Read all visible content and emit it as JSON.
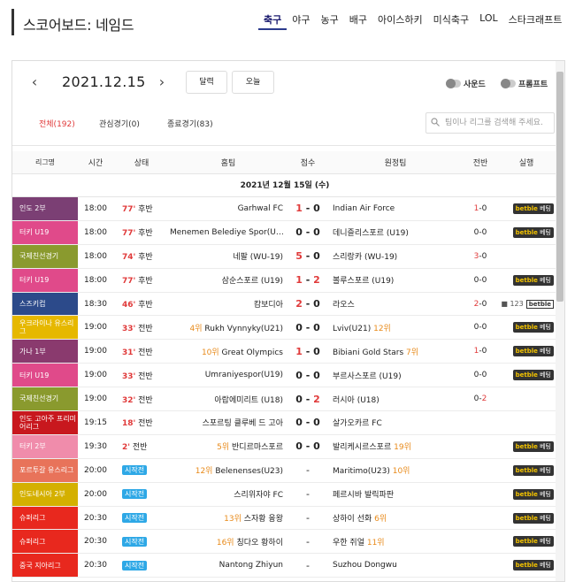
{
  "header": {
    "title": "스코어보드: 네임드",
    "nav": [
      "축구",
      "야구",
      "농구",
      "배구",
      "아이스하키",
      "미식축구",
      "LOL",
      "스타크래프트"
    ]
  },
  "controls": {
    "date": "2021.12.15",
    "calendar_label": "달력",
    "today_label": "오늘",
    "sound_label": "사운드",
    "proto_label": "프롬프트",
    "tabs": [
      "전체(192)",
      "관심경기(0)",
      "종료경기(83)"
    ],
    "search_placeholder": "팀이나 리그를 검색해 주세요."
  },
  "table": {
    "columns": [
      "리그명",
      "시간",
      "상태",
      "홈팀",
      "점수",
      "원정팀",
      "전반",
      "실행"
    ],
    "date_header": "2021년 12월 15일 (수)",
    "rows": [
      {
        "league": "인도 2부",
        "color": "#7b3f74",
        "time": "18:00",
        "status_min": "77'",
        "status": "후반",
        "home_rank": "",
        "home": "Garhwal FC",
        "score_h": "1",
        "score_a": "0",
        "away": "Indian Air Force",
        "away_rank": "",
        "half_h": "1",
        "half_a": "0",
        "action": "betble"
      },
      {
        "league": "터키 U19",
        "color": "#e04a8a",
        "time": "18:00",
        "status_min": "77'",
        "status": "후반",
        "home_rank": "",
        "home": "Menemen Belediye Spor(U…",
        "score_h": "0",
        "score_a": "0",
        "away": "데니즐리스포르 (U19)",
        "away_rank": "",
        "half_h": "0",
        "half_a": "0",
        "action": "betble"
      },
      {
        "league": "국제친선경기",
        "color": "#8a9a2e",
        "time": "18:00",
        "status_min": "74'",
        "status": "후반",
        "home_rank": "",
        "home": "네팔 (WU-19)",
        "score_h": "5",
        "score_a": "0",
        "away": "스리랑카 (WU-19)",
        "away_rank": "",
        "half_h": "3",
        "half_a": "0",
        "action": ""
      },
      {
        "league": "터키 U19",
        "color": "#e04a8a",
        "time": "18:00",
        "status_min": "77'",
        "status": "후반",
        "home_rank": "",
        "home": "삼순스포르 (U19)",
        "score_h": "1",
        "score_a": "2",
        "away": "볼루스포르 (U19)",
        "away_rank": "",
        "half_h": "0",
        "half_a": "0",
        "action": "betble"
      },
      {
        "league": "스즈키컵",
        "color": "#2c4a8a",
        "time": "18:30",
        "status_min": "46'",
        "status": "후반",
        "home_rank": "",
        "home": "캄보디아",
        "score_h": "2",
        "score_a": "0",
        "away": "라오스",
        "away_rank": "",
        "half_h": "2",
        "half_a": "0",
        "action": "cam"
      },
      {
        "league": "우크라이나 유스리그",
        "color": "#e6b800",
        "time": "19:00",
        "status_min": "33'",
        "status": "전반",
        "home_rank": "4위",
        "home": "Rukh Vynnyky(U21)",
        "score_h": "0",
        "score_a": "0",
        "away": "Lviv(U21)",
        "away_rank": "12위",
        "half_h": "0",
        "half_a": "0",
        "action": "betble"
      },
      {
        "league": "가나 1부",
        "color": "#8a3a6e",
        "time": "19:00",
        "status_min": "31'",
        "status": "전반",
        "home_rank": "10위",
        "home": "Great Olympics",
        "score_h": "1",
        "score_a": "0",
        "away": "Bibiani Gold Stars",
        "away_rank": "7위",
        "half_h": "1",
        "half_a": "0",
        "action": "betble"
      },
      {
        "league": "터키 U19",
        "color": "#e04a8a",
        "time": "19:00",
        "status_min": "33'",
        "status": "전반",
        "home_rank": "",
        "home": "Umraniyespor(U19)",
        "score_h": "0",
        "score_a": "0",
        "away": "부르사스포르 (U19)",
        "away_rank": "",
        "half_h": "0",
        "half_a": "0",
        "action": "betble"
      },
      {
        "league": "국제친선경기",
        "color": "#8a9a2e",
        "time": "19:00",
        "status_min": "32'",
        "status": "전반",
        "home_rank": "",
        "home": "아랍에미리트 (U18)",
        "score_h": "0",
        "score_a": "2",
        "away": "러시아 (U18)",
        "away_rank": "",
        "half_h": "0",
        "half_a": "2",
        "action": ""
      },
      {
        "league": "인도 고아주 프리미어리그",
        "color": "#c8181e",
        "time": "19:15",
        "status_min": "18'",
        "status": "전반",
        "home_rank": "",
        "home": "스포르팅 클루베 드 고아",
        "score_h": "0",
        "score_a": "0",
        "away": "살가오카르 FC",
        "away_rank": "",
        "half_h": "",
        "half_a": "",
        "action": ""
      },
      {
        "league": "터키 2부",
        "color": "#f08cab",
        "time": "19:30",
        "status_min": "2'",
        "status": "전반",
        "home_rank": "5위",
        "home": "반디르마스포르",
        "score_h": "0",
        "score_a": "0",
        "away": "발리케시르스포르",
        "away_rank": "19위",
        "half_h": "",
        "half_a": "",
        "action": "betble"
      },
      {
        "league": "포르투갈 유스리그",
        "color": "#e8735a",
        "time": "20:00",
        "status_min": "",
        "status": "시작전",
        "home_rank": "12위",
        "home": "Belenenses(U23)",
        "score_h": "",
        "score_a": "",
        "away": "Maritimo(U23)",
        "away_rank": "10위",
        "half_h": "",
        "half_a": "",
        "action": "betble"
      },
      {
        "league": "인도네시아 2부",
        "color": "#d4b000",
        "time": "20:00",
        "status_min": "",
        "status": "시작전",
        "home_rank": "",
        "home": "스리위자야 FC",
        "score_h": "",
        "score_a": "",
        "away": "페르시바 발릭파판",
        "away_rank": "",
        "half_h": "",
        "half_a": "",
        "action": "betble"
      },
      {
        "league": "슈퍼리그",
        "color": "#e8281e",
        "time": "20:30",
        "status_min": "",
        "status": "시작전",
        "home_rank": "13위",
        "home": "스자황 융왕",
        "score_h": "",
        "score_a": "",
        "away": "상하이 선화",
        "away_rank": "6위",
        "half_h": "",
        "half_a": "",
        "action": "betble"
      },
      {
        "league": "슈퍼리그",
        "color": "#e8281e",
        "time": "20:30",
        "status_min": "",
        "status": "시작전",
        "home_rank": "16위",
        "home": "칭다오 황하이",
        "score_h": "",
        "score_a": "",
        "away": "우한 쥐얼",
        "away_rank": "11위",
        "half_h": "",
        "half_a": "",
        "action": "betble"
      },
      {
        "league": "중국 지아리그",
        "color": "#e8281e",
        "time": "20:30",
        "status_min": "",
        "status": "시작전",
        "home_rank": "",
        "home": "Nantong Zhiyun",
        "score_h": "",
        "score_a": "",
        "away": "Suzhou Dongwu",
        "away_rank": "",
        "half_h": "",
        "half_a": "",
        "action": "betble"
      }
    ]
  },
  "widgets": {
    "betble_text": "betble",
    "betble_suffix": "베팅",
    "cam_count": "123",
    "betble_outline": "betble",
    "score_separator": "-",
    "half_separator": "-"
  }
}
